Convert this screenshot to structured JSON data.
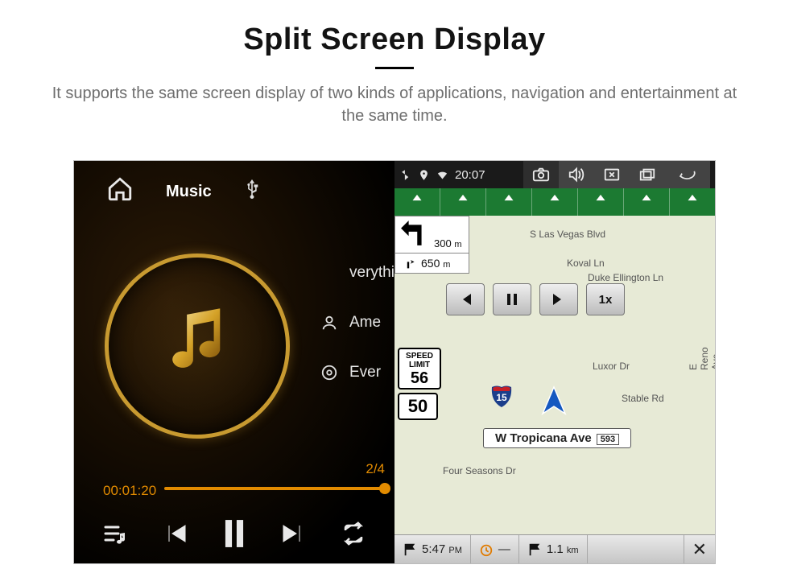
{
  "header": {
    "title": "Split Screen Display",
    "subtitle": "It supports the same screen display of two kinds of applications, navigation and entertainment at the same time."
  },
  "music": {
    "app_label": "Music",
    "source": "usb",
    "tracks": [
      "verythin",
      "Ame",
      "Ever"
    ],
    "counter": "2/4",
    "elapsed": "00:01:20"
  },
  "status": {
    "time": "20:07"
  },
  "nav": {
    "turn1_dist": "300",
    "turn1_unit": "m",
    "turn2_dist": "650",
    "turn2_unit": "m",
    "speed_limit_label_top": "SPEED",
    "speed_limit_label_bot": "LIMIT",
    "speed_limit": "56",
    "current_speed": "50",
    "streets": {
      "vegas": "S Las Vegas Blvd",
      "koval": "Koval Ln",
      "duke": "Duke Ellington Ln",
      "luxor": "Luxor Dr",
      "stable": "Stable Rd",
      "reno": "E Reno Ave",
      "four": "Four Seasons Dr"
    },
    "current_road": "W Tropicana Ave",
    "exit": "593",
    "route_shield": "15",
    "playback_speed": "1x",
    "eta": "5:47",
    "eta_suffix": "PM",
    "trip_time": "—",
    "dist_remain": "1.1",
    "dist_unit": "km"
  }
}
